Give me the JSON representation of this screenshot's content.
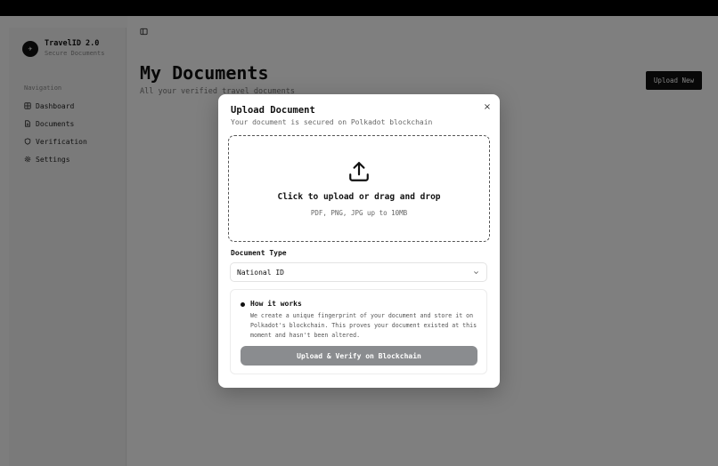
{
  "app": {
    "brand_name": "TravelID 2.0",
    "brand_tagline": "Secure Documents"
  },
  "sidebar": {
    "section_label": "Navigation",
    "items": [
      {
        "label": "Dashboard",
        "icon": "grid-icon"
      },
      {
        "label": "Documents",
        "icon": "file-icon"
      },
      {
        "label": "Verification",
        "icon": "shield-icon"
      },
      {
        "label": "Settings",
        "icon": "gear-icon"
      }
    ]
  },
  "main": {
    "title": "My Documents",
    "subtitle": "All your verified travel documents",
    "upload_new_label": "Upload New"
  },
  "modal": {
    "title": "Upload Document",
    "subtitle": "Your document is secured on Polkadot blockchain",
    "close_label": "×",
    "dropzone": {
      "title": "Click to upload or drag and drop",
      "hint": "PDF, PNG, JPG up to 10MB"
    },
    "doc_type_label": "Document Type",
    "doc_type_value": "National ID",
    "how": {
      "title": "How it works",
      "text": "We create a unique fingerprint of your document and store it on Polkadot's blockchain. This proves your document existed at this moment and hasn't been altered."
    },
    "submit_label": "Upload & Verify on Blockchain"
  },
  "colors": {
    "accent": "#111111",
    "submit_disabled": "#8a8c8f",
    "overlay": "rgba(0,0,0,0.5)"
  }
}
